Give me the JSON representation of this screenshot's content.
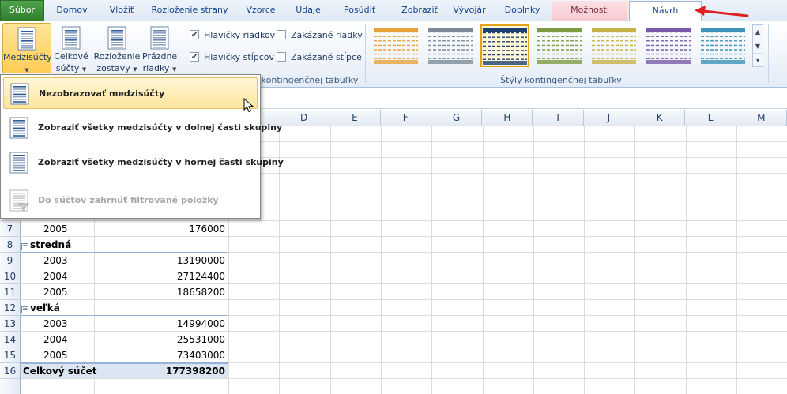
{
  "tabs": [
    {
      "label": "Súbor",
      "kind": "file"
    },
    {
      "label": "Domov",
      "kind": "normal"
    },
    {
      "label": "Vložiť",
      "kind": "normal"
    },
    {
      "label": "Rozloženie strany",
      "kind": "normal"
    },
    {
      "label": "Vzorce",
      "kind": "normal"
    },
    {
      "label": "Údaje",
      "kind": "normal"
    },
    {
      "label": "Posúdiť",
      "kind": "normal"
    },
    {
      "label": "Zobraziť",
      "kind": "normal"
    },
    {
      "label": "Vývojár",
      "kind": "normal"
    },
    {
      "label": "Doplnky",
      "kind": "normal"
    },
    {
      "label": "Možnosti",
      "kind": "context"
    },
    {
      "label": "Návrh",
      "kind": "active"
    }
  ],
  "ribbon": {
    "layout_buttons": [
      {
        "line1": "Medzisúčty",
        "line2": ""
      },
      {
        "line1": "Celkové",
        "line2": "súčty"
      },
      {
        "line1": "Rozloženie",
        "line2": "zostavy"
      },
      {
        "line1": "Prázdne",
        "line2": "riadky"
      }
    ],
    "checkboxes": [
      {
        "label": "Hlavičky riadkov",
        "checked": true
      },
      {
        "label": "Zakázané riadky",
        "checked": false
      },
      {
        "label": "Hlavičky stĺpcov",
        "checked": true
      },
      {
        "label": "Zakázané stĺpce",
        "checked": false
      }
    ],
    "style_options_group_label": "kontingenčnej tabuľky",
    "styles_group_label": "Štýly kontingenčnej tabuľky",
    "swatch_colors": [
      "#e8a33c",
      "#7d8a99",
      "#1f3f73",
      "#7d9b42",
      "#c7b24a",
      "#7a5aa8",
      "#3e92b8"
    ],
    "selected_swatch": 2
  },
  "dropdown": {
    "items": [
      {
        "label": "Nezobrazovať medzisúčty",
        "state": "hover"
      },
      {
        "label": "Zobraziť všetky medzisúčty v dolnej časti skupiny",
        "state": "normal"
      },
      {
        "label": "Zobraziť všetky medzisúčty v hornej časti skupiny",
        "state": "normal"
      },
      {
        "label": "Do súčtov zahrnúť filtrované položky",
        "state": "disabled"
      }
    ]
  },
  "columns": [
    "D",
    "E",
    "F",
    "G",
    "H",
    "I",
    "J",
    "K",
    "L",
    "M"
  ],
  "rows": [
    {
      "num": "7",
      "a": "2005",
      "b": "176000",
      "kind": "year"
    },
    {
      "num": "8",
      "a": "stredná",
      "b": "",
      "kind": "category"
    },
    {
      "num": "9",
      "a": "2003",
      "b": "13190000",
      "kind": "year"
    },
    {
      "num": "10",
      "a": "2004",
      "b": "27124400",
      "kind": "year"
    },
    {
      "num": "11",
      "a": "2005",
      "b": "18658200",
      "kind": "year"
    },
    {
      "num": "12",
      "a": "veľká",
      "b": "",
      "kind": "category"
    },
    {
      "num": "13",
      "a": "2003",
      "b": "14994000",
      "kind": "year"
    },
    {
      "num": "14",
      "a": "2004",
      "b": "25531000",
      "kind": "year"
    },
    {
      "num": "15",
      "a": "2005",
      "b": "73403000",
      "kind": "year"
    },
    {
      "num": "16",
      "a": "Celkový súčet",
      "b": "177398200",
      "kind": "total"
    }
  ],
  "colors": {
    "accent_arrow": "#e02020",
    "file_tab": "#3a8a37",
    "context_tab": "#f7cfd6"
  }
}
